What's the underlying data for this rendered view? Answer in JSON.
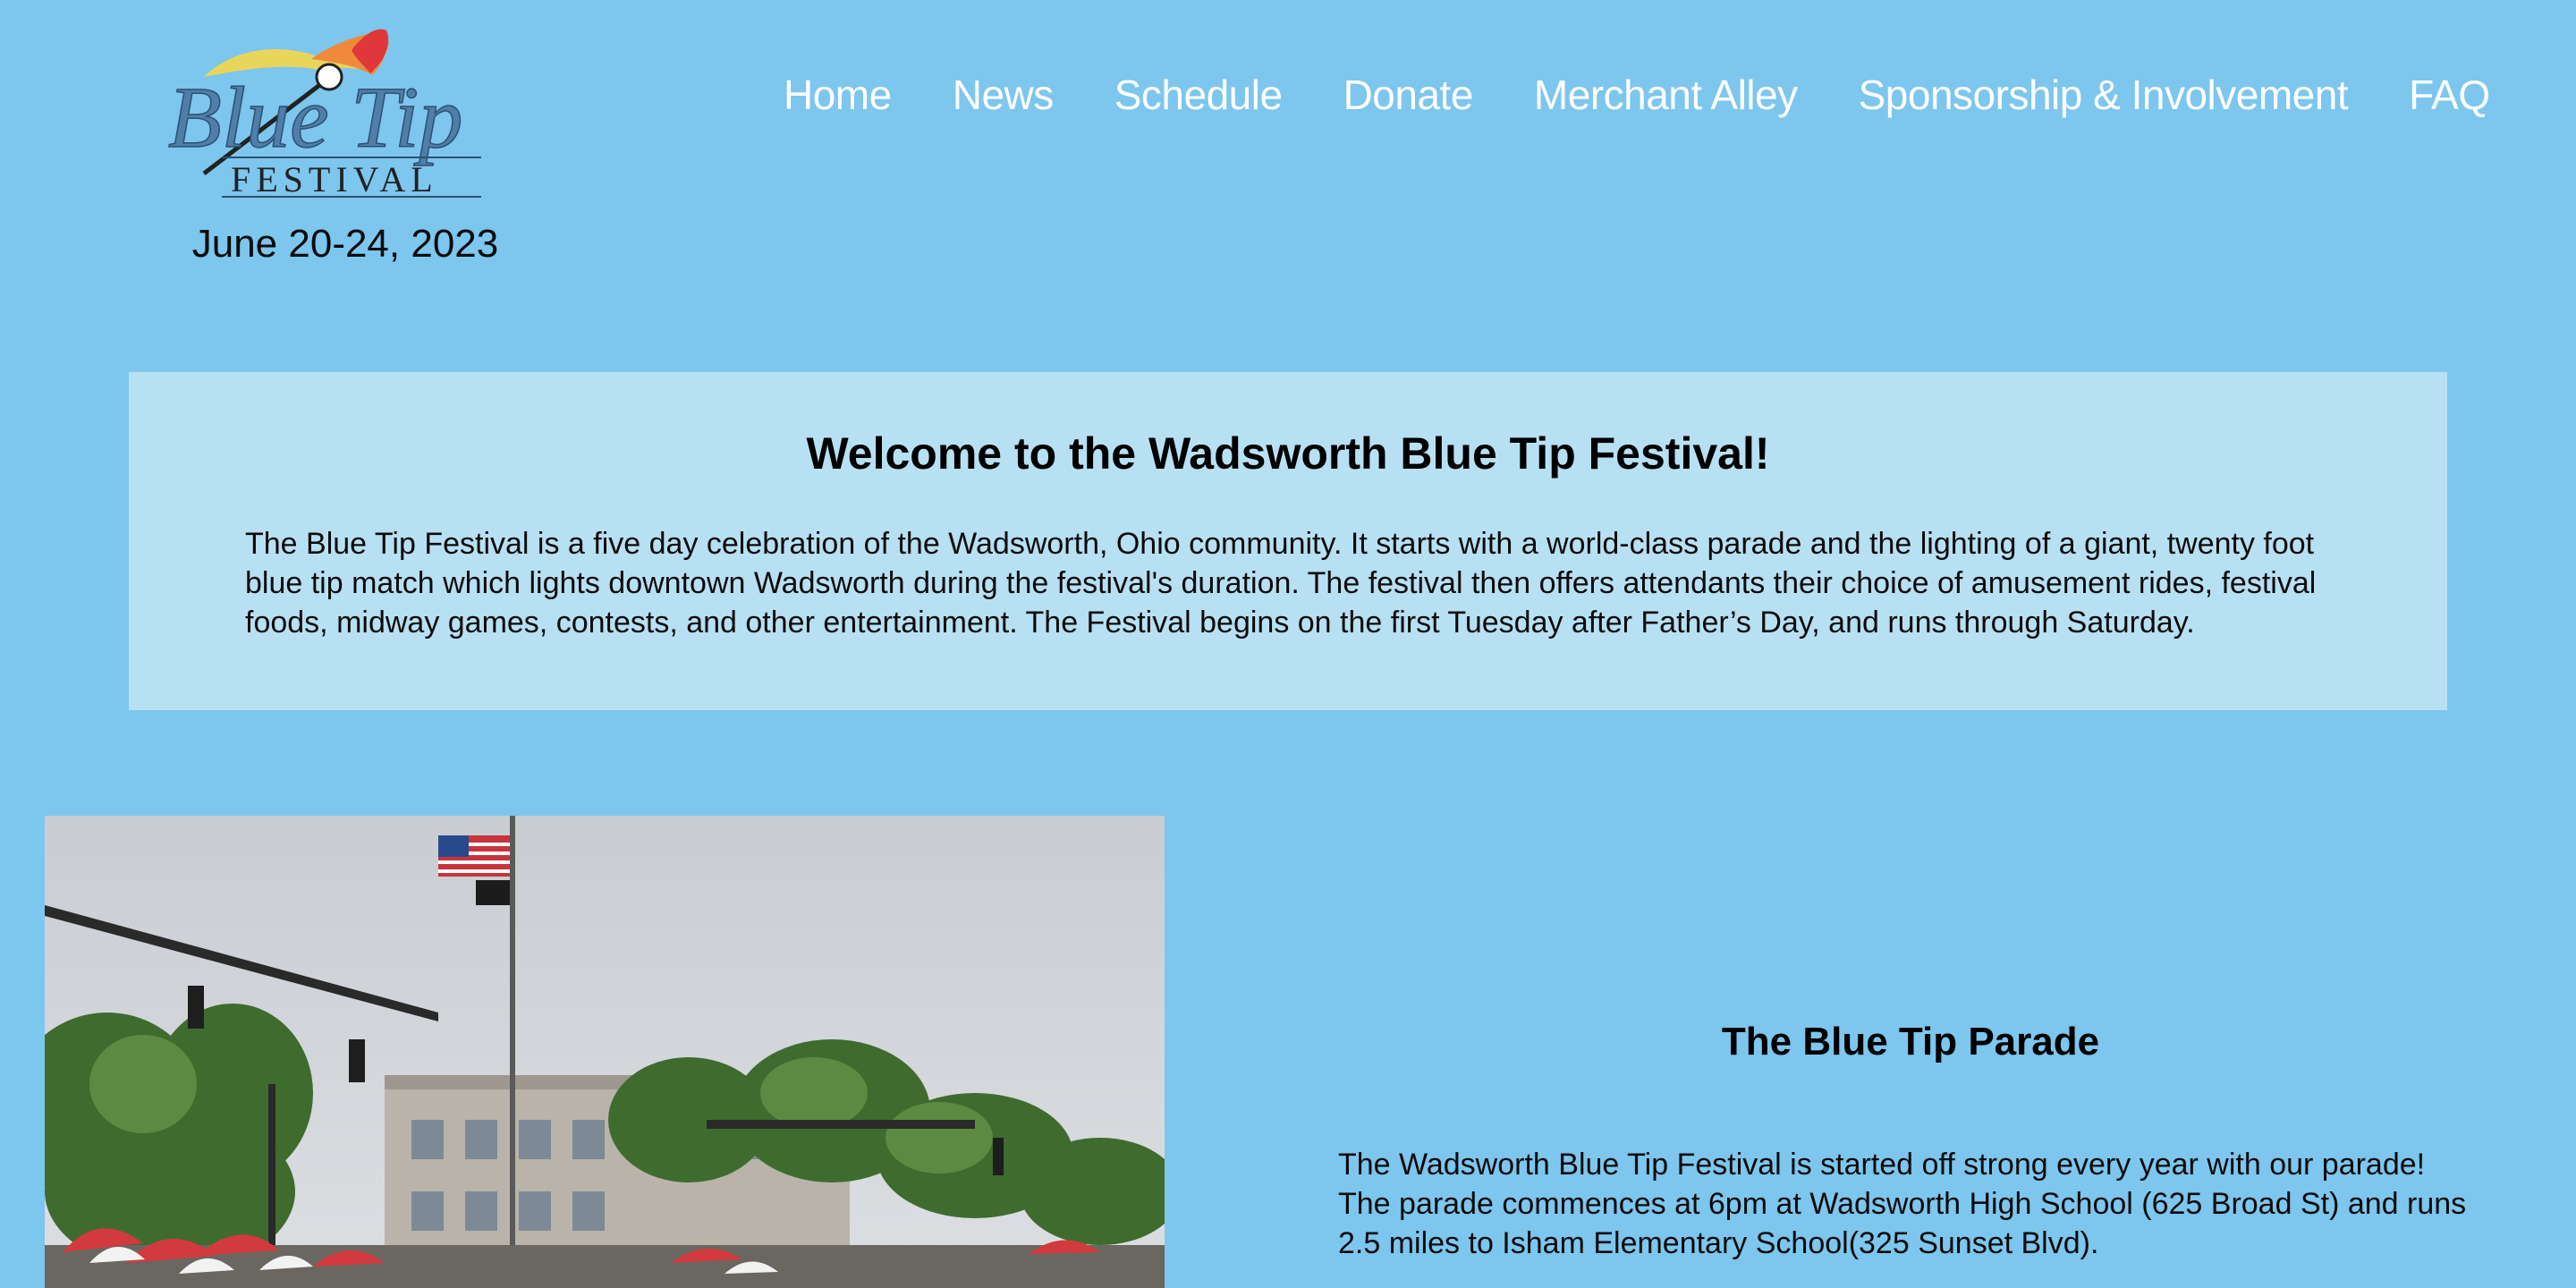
{
  "header": {
    "logo": {
      "wordmark": "Blue Tip",
      "subtitle": "FESTIVAL"
    },
    "dates": "June 20-24, 2023",
    "nav": [
      {
        "label": "Home"
      },
      {
        "label": "News"
      },
      {
        "label": "Schedule"
      },
      {
        "label": "Donate"
      },
      {
        "label": "Merchant Alley"
      },
      {
        "label": "Sponsorship & Involvement"
      },
      {
        "label": "FAQ"
      }
    ]
  },
  "welcome": {
    "title": "Welcome to the Wadsworth Blue Tip Festival!",
    "body": "The Blue Tip Festival is a five day celebration of the Wadsworth, Ohio community. It starts with a world-class parade and the lighting of a giant, twenty foot blue tip match which lights downtown Wadsworth during the festival's duration. The festival then offers attendants their choice of amusement rides, festival foods, midway games, contests, and other entertainment. The Festival begins on the first Tuesday after Father’s Day, and runs through Saturday."
  },
  "parade": {
    "title": "The Blue Tip Parade",
    "body": "The Wadsworth Blue Tip Festival is started off strong every year with our parade! The parade commences at 6pm at Wadsworth High School (625 Broad St) and runs 2.5 miles to Isham Elementary School(325 Sunset Blvd)."
  },
  "colors": {
    "page_bg": "#7dc6ee",
    "welcome_bg": "#b8e0f3",
    "nav_text": "#ffffff",
    "logo_blue": "#4f7fa8"
  }
}
